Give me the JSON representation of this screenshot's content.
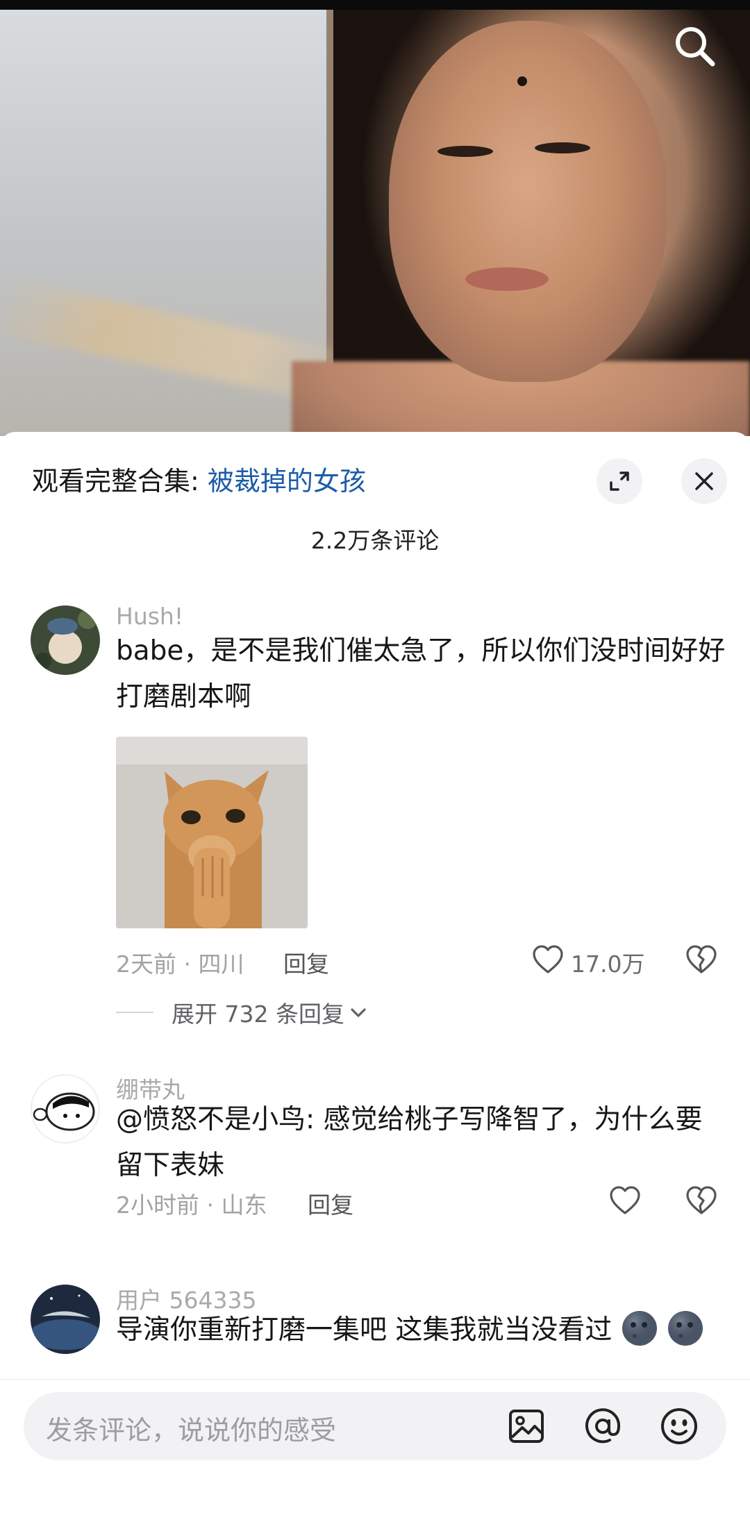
{
  "video": {
    "search_icon": "search-icon"
  },
  "sheet": {
    "collection_prefix": "观看完整合集: ",
    "collection_link": "被裁掉的女孩",
    "comment_count": "2.2万条评论"
  },
  "comments": [
    {
      "user": "Hush!",
      "text": "babe，是不是我们催太急了，所以你们没时间好好打磨剧本啊",
      "meta": "2天前 · 四川",
      "reply_label": "回复",
      "likes": "17.0万",
      "expand_label": "展开 732 条回复"
    },
    {
      "user": "绷带丸",
      "text": "@愤怒不是小鸟: 感觉给桃子写降智了，为什么要留下表妹",
      "meta": "2小时前 · 山东",
      "reply_label": "回复"
    },
    {
      "user": "用户 564335",
      "text": "导演你重新打磨一集吧 这集我就当没看过"
    }
  ],
  "input": {
    "placeholder": "发条评论，说说你的感受"
  },
  "colors": {
    "link": "#1c5ba8",
    "muted": "#a9a9ad",
    "input_bg": "#f2f2f4"
  }
}
